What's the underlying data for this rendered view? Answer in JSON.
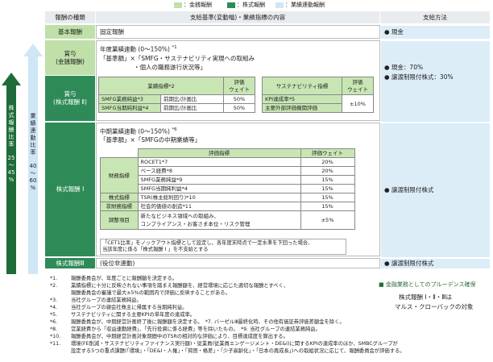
{
  "legend": {
    "green": "：金銭報酬",
    "dark_green": "：株式報酬",
    "blue": "：業績連動報酬"
  },
  "header": {
    "type": "報酬の種類",
    "basis": "支給基準(変動幅)・業績指標の内容",
    "method": "支給方法"
  },
  "rows": {
    "base": {
      "label": "基本報酬",
      "content": "固定報酬",
      "method": "● 現金"
    },
    "bonus_cash": {
      "label": [
        "賞与",
        "(金銭報酬)"
      ]
    },
    "bonus_stock": {
      "label": [
        "賞与",
        "(株式報酬 Ⅱ)"
      ]
    },
    "stock1": {
      "label": "株式報酬 Ⅰ"
    },
    "stock3": {
      "label": "株式報酬Ⅲ",
      "content": "(役位非連動)",
      "method": "● 譲渡制限付株式"
    }
  },
  "bonus": {
    "title": "年度業績連動 (0〜150%)",
    "title_note": "*1",
    "formula1": "「基準額」×「SMFG・サステナビリティ実現への取組み",
    "formula2": "・個人の職務遂行状況等」",
    "method1": "● 現金：70%",
    "method2": "● 譲渡制限付株式：30%",
    "table_left": {
      "headers": [
        "業績指標",
        "*2",
        "評価ウェイト"
      ],
      "header_label": "業績指標*2",
      "weight_label": [
        "評価",
        "ウェイト"
      ],
      "rows": [
        [
          "SMFG業務純益*3",
          "前期比/計画比",
          "50%"
        ],
        [
          "SMFG当期純利益*4",
          "前期比/計画比",
          "50%"
        ]
      ]
    },
    "table_right": {
      "header_label": "サステナビリティ指標",
      "weight_label": [
        "評価",
        "ウェイト"
      ],
      "rows": [
        "KPI達成率*5",
        "主要外部評価機関評価"
      ],
      "weight": "±10%"
    }
  },
  "stock1": {
    "title": "中期業績連動 (0〜150%)",
    "title_note": "*6",
    "formula": "「基準額」×「SMFGの中期業績等」",
    "method": "● 譲渡制限付株式",
    "table": {
      "header": [
        "評価指標",
        "評価ウェイト"
      ],
      "groups": [
        {
          "name": "財務指標",
          "items": [
            [
              "ROCET1*7",
              "20%"
            ],
            [
              "ベース経費*8",
              "20%"
            ],
            [
              "SMFG業務純益*9",
              "15%"
            ],
            [
              "SMFG当期純利益*4",
              "15%"
            ]
          ]
        },
        {
          "name": "株式指標",
          "items": [
            [
              "TSR(株主総利回り)*10",
              "15%"
            ]
          ]
        },
        {
          "name": "非財務指標",
          "items": [
            [
              "社会的価値の創造*11",
              "15%"
            ]
          ]
        },
        {
          "name": "調整項目",
          "items": [
            [
              "新たなビジネス領域への取組み、",
              "±5%"
            ],
            [
              "コンプライアンス・お客さま本位・リスク管理",
              ""
            ]
          ]
        }
      ]
    },
    "cet_note1": "「CET1比率」をノックアウト指標として設定し、各年度末時点で一定水準を下回った場合、",
    "cet_note2": "当該年度に係る「株式報酬 Ⅰ 」を不支給とする"
  },
  "side_arrows": {
    "dark_label": [
      "株",
      "式",
      "報",
      "酬",
      "比",
      "率"
    ],
    "dark_range": [
      "25",
      "〜",
      "45",
      "%"
    ],
    "light_label": [
      "業",
      "績",
      "連",
      "動",
      "比",
      "率"
    ],
    "light_range": [
      "40",
      "〜",
      "60",
      "%"
    ]
  },
  "prudence": {
    "label": "■ 金融業務としてのプルーデンス確保",
    "malus1": "株式報酬 Ⅰ・Ⅱ・Ⅲは",
    "malus2": "マルス・クローバックの対象"
  },
  "notes": [
    [
      "*1.",
      "報酬委員会が、年度ごとに報酬額を決定する。"
    ],
    [
      "*2.",
      "業績指標に十分に反映されない事項を踏まえ報酬額を、経営環境に応じた適切な報酬とすべく、"
    ],
    [
      "",
      "報酬委員会の審議で最大±5%の範囲内で評価に反映することがある。"
    ],
    [
      "*3.",
      "当社グループの連結業務純益。"
    ],
    [
      "*4.",
      "当社グループの親会社株主に帰属する当期純利益。"
    ],
    [
      "*5.",
      "サステナビリティに関する主要KPIの単年度の達成率。"
    ],
    [
      "*6.",
      "報酬委員会が、中期経営計画終了後に報酬額を決定する。　*7. バーゼルⅢ最終化時、その他有価証券評価差額金を除く。"
    ],
    [
      "*8.",
      "営業経費から「収益連動経費」、「先行投資に係る経費」等を除いたもの。　*9. 当社グループの連結業務純益。"
    ],
    [
      "*10.",
      "報酬委員会が、中期経営計画対象期間中のTSRの相対的な評価により、目標達成度を算出する。"
    ],
    [
      "*11.",
      "環境(FE削減・サステナビリティファイナンス実行額)・従業員(従業員エンゲージメント・DE&I)に関するKPIの達成率のほか、SMBCグループが"
    ],
    [
      "",
      "設定する5つの重点課題(「環境」・「DE&I・人権」・「貧困・格差」・「少子高齢化」・「日本の再成長」)への取組状況に応じて、報酬委員会が評価する。"
    ]
  ],
  "colors": {
    "green": "#bfe0a8",
    "dark_green": "#2e8b57",
    "blue": "#cfe6f7",
    "arrow_dark": "#1f6b3a",
    "arrow_light": "#cfe6f7"
  }
}
